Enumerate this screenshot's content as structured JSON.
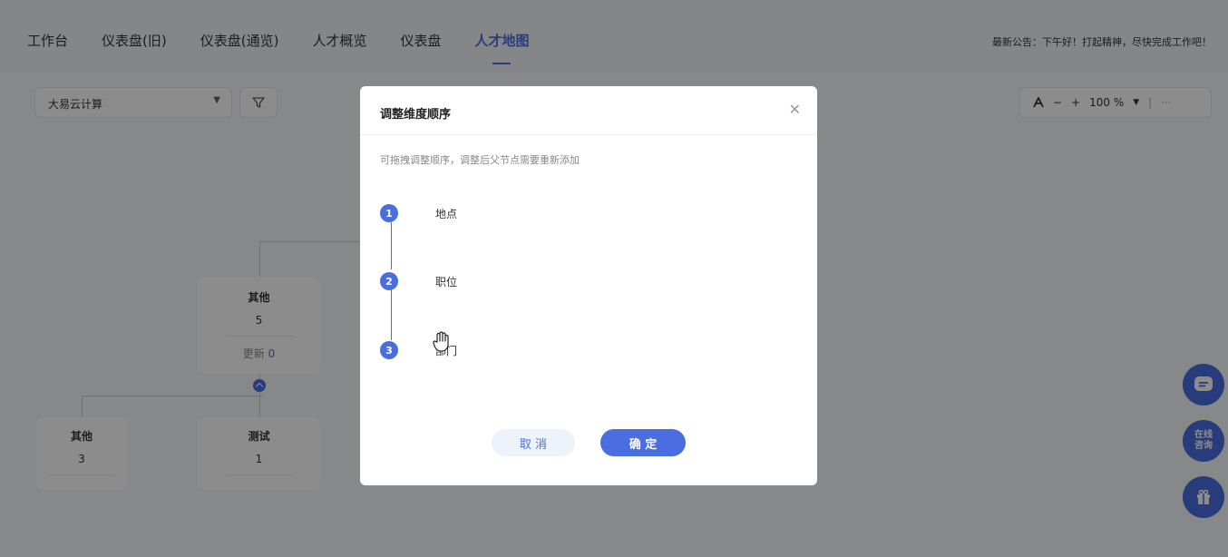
{
  "nav": {
    "tabs": [
      "工作台",
      "仪表盘(旧)",
      "仪表盘(通览)",
      "人才概览",
      "仪表盘",
      "人才地图"
    ],
    "active_index": 5,
    "announcement": "最新公告：下午好！打起精神，尽快完成工作吧！"
  },
  "toolbar": {
    "company_select": "大易云计算",
    "zoom_value": "100 %",
    "zoom_minus": "−",
    "zoom_plus": "+",
    "more": "···"
  },
  "tree": {
    "main_node": {
      "title": "其他",
      "count": "5",
      "update_label": "更新",
      "update_count": "0"
    },
    "child_nodes": [
      {
        "title": "其他",
        "count": "3"
      },
      {
        "title": "测试",
        "count": "1"
      }
    ]
  },
  "side_buttons": {
    "consult_line1": "在线",
    "consult_line2": "咨询"
  },
  "modal": {
    "title": "调整维度顺序",
    "hint": "可拖拽调整顺序，调整后父节点需要重新添加",
    "steps": [
      {
        "num": "1",
        "label": "地点"
      },
      {
        "num": "2",
        "label": "职位"
      },
      {
        "num": "3",
        "label": "部门"
      }
    ],
    "cancel_label": "取 消",
    "confirm_label": "确 定"
  },
  "colors": {
    "accent": "#4a6ee0",
    "overlay": "rgba(0,0,0,0.45)"
  }
}
